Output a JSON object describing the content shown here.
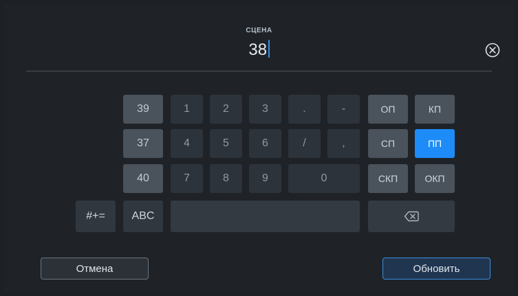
{
  "field": {
    "label": "СЦЕНА",
    "value": "38"
  },
  "icons": {
    "clear": "clear-circle-x-icon",
    "backspace": "backspace-icon"
  },
  "keypad": {
    "recent": [
      "39",
      "37",
      "40"
    ],
    "row1": [
      "1",
      "2",
      "3",
      ".",
      "-"
    ],
    "row2": [
      "4",
      "5",
      "6",
      "/",
      ","
    ],
    "row3": [
      "7",
      "8",
      "9",
      "0"
    ],
    "types": [
      "ОП",
      "КП",
      "СП",
      "ПП",
      "СКП",
      "ОКП"
    ],
    "active_type": "ПП",
    "symbols_label": "#+=",
    "abc_label": "ABC"
  },
  "buttons": {
    "cancel": "Отмена",
    "update": "Обновить"
  },
  "colors": {
    "accent": "#1d8cf8",
    "background": "#1f2328"
  }
}
